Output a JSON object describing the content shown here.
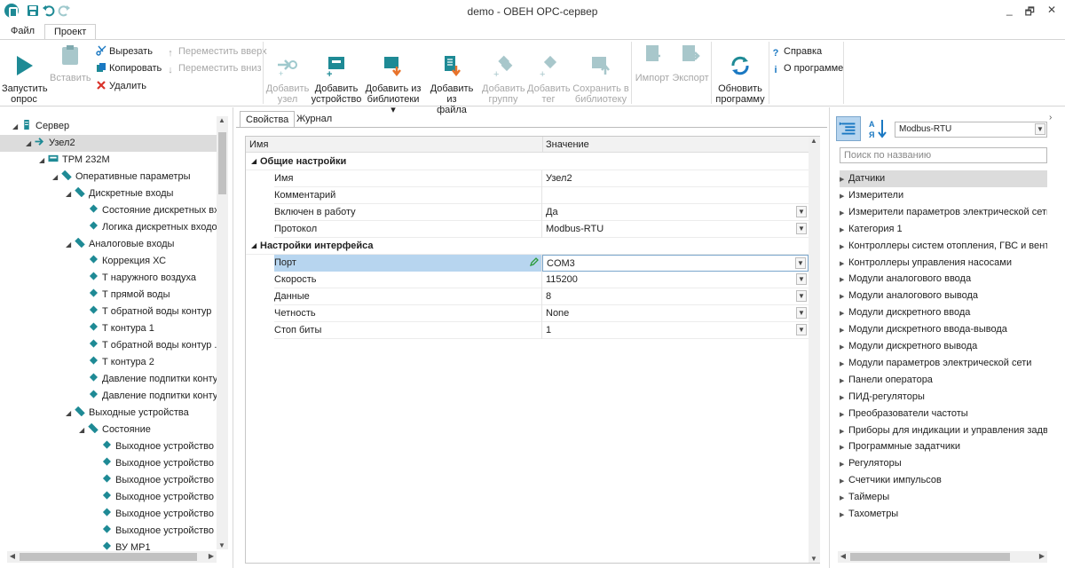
{
  "window": {
    "title": "demo - ОВЕН OPC-сервер",
    "controls": [
      "_",
      "🗗",
      "✕"
    ]
  },
  "menu_tabs": [
    "Файл",
    "Проект"
  ],
  "ribbon": {
    "start_poll": "Запустить\nопрос",
    "paste": "Вставить",
    "cut": "Вырезать",
    "copy": "Копировать",
    "delete": "Удалить",
    "move_up": "Переместить вверх",
    "move_down": "Переместить вниз",
    "add_node": "Добавить\nузел",
    "add_device": "Добавить\nустройство",
    "add_from_library": "Добавить из\nбиблиотеки ▾",
    "add_from_file": "Добавить из\nфайла",
    "add_group": "Добавить\nгруппу",
    "add_tag": "Добавить\nтег",
    "save_to_library": "Сохранить в\nбиблиотеку",
    "import": "Импорт",
    "export": "Экспорт",
    "update_program": "Обновить\nпрограмму",
    "help": "Справка",
    "about": "О программе"
  },
  "tree": [
    {
      "label": "Сервер",
      "level": 0,
      "icon": "server-icon",
      "expanded": true
    },
    {
      "label": "Узел2",
      "level": 1,
      "icon": "node-arrow-icon",
      "expanded": true,
      "selected": true
    },
    {
      "label": "ТРМ 232М",
      "level": 2,
      "icon": "device-icon",
      "expanded": true
    },
    {
      "label": "Оперативные параметры",
      "level": 3,
      "icon": "group-icon",
      "expanded": true
    },
    {
      "label": "Дискретные входы",
      "level": 4,
      "icon": "group-icon",
      "expanded": true
    },
    {
      "label": "Состояние дискретных вх",
      "level": 5,
      "icon": "tag-icon"
    },
    {
      "label": "Логика дискретных входо",
      "level": 5,
      "icon": "tag-icon"
    },
    {
      "label": "Аналоговые входы",
      "level": 4,
      "icon": "group-icon",
      "expanded": true
    },
    {
      "label": "Коррекция ХС",
      "level": 5,
      "icon": "tag-icon"
    },
    {
      "label": "Т наружного воздуха",
      "level": 5,
      "icon": "tag-icon"
    },
    {
      "label": "Т прямой воды",
      "level": 5,
      "icon": "tag-icon"
    },
    {
      "label": "Т обратной воды контур",
      "level": 5,
      "icon": "tag-icon"
    },
    {
      "label": "Т контура 1",
      "level": 5,
      "icon": "tag-icon"
    },
    {
      "label": "Т обратной воды контур .",
      "level": 5,
      "icon": "tag-icon"
    },
    {
      "label": "Т контура 2",
      "level": 5,
      "icon": "tag-icon"
    },
    {
      "label": "Давление подпитки конту",
      "level": 5,
      "icon": "tag-icon"
    },
    {
      "label": "Давление подпитки конту",
      "level": 5,
      "icon": "tag-icon"
    },
    {
      "label": "Выходные устройства",
      "level": 4,
      "icon": "group-icon",
      "expanded": true
    },
    {
      "label": "Состояние",
      "level": 5,
      "icon": "group-icon",
      "expanded": true
    },
    {
      "label": "Выходное устройство",
      "level": 6,
      "icon": "tag-icon"
    },
    {
      "label": "Выходное устройство",
      "level": 6,
      "icon": "tag-icon"
    },
    {
      "label": "Выходное устройство",
      "level": 6,
      "icon": "tag-icon"
    },
    {
      "label": "Выходное устройство",
      "level": 6,
      "icon": "tag-icon"
    },
    {
      "label": "Выходное устройство",
      "level": 6,
      "icon": "tag-icon"
    },
    {
      "label": "Выходное устройство",
      "level": 6,
      "icon": "tag-icon"
    },
    {
      "label": "ВУ МР1",
      "level": 6,
      "icon": "tag-icon"
    }
  ],
  "center_tabs": [
    "Свойства",
    "Журнал"
  ],
  "grid": {
    "col_name": "Имя",
    "col_value": "Значение",
    "rows": [
      {
        "type": "category",
        "name": "Общие настройки"
      },
      {
        "type": "prop",
        "name": "Имя",
        "value": "Узел2"
      },
      {
        "type": "prop",
        "name": "Комментарий",
        "value": ""
      },
      {
        "type": "prop",
        "name": "Включен в работу",
        "value": "Да",
        "dropdown": true
      },
      {
        "type": "prop",
        "name": "Протокол",
        "value": "Modbus-RTU",
        "dropdown": true
      },
      {
        "type": "category",
        "name": "Настройки интерфейса"
      },
      {
        "type": "prop",
        "name": "Порт",
        "value": "COM3",
        "dropdown": true,
        "selected": true
      },
      {
        "type": "prop",
        "name": "Скорость",
        "value": "115200",
        "dropdown": true
      },
      {
        "type": "prop",
        "name": "Данные",
        "value": "8",
        "dropdown": true
      },
      {
        "type": "prop",
        "name": "Четность",
        "value": "None",
        "dropdown": true
      },
      {
        "type": "prop",
        "name": "Стоп биты",
        "value": "1",
        "dropdown": true
      }
    ]
  },
  "library": {
    "protocol_select": "Modbus-RTU",
    "search_placeholder": "Поиск по названию",
    "categories": [
      "Датчики",
      "Измерители",
      "Измерители параметров электрической сети",
      "Категория 1",
      "Контроллеры систем отопления, ГВС и вентиляции",
      "Контроллеры управления насосами",
      "Модули аналогового ввода",
      "Модули аналогового вывода",
      "Модули дискретного ввода",
      "Модули дискретного ввода-вывода",
      "Модули дискретного вывода",
      "Модули параметров электрической сети",
      "Панели оператора",
      "ПИД-регуляторы",
      "Преобразователи частоты",
      "Приборы для индикации и управления задвижками",
      "Программные задатчики",
      "Регуляторы",
      "Счетчики импульсов",
      "Таймеры",
      "Тахометры"
    ]
  },
  "colors": {
    "accent": "#1e8a95",
    "selection": "#b7d5ef",
    "tree_selected": "#dcdcdc",
    "icon_orange": "#e8722a",
    "icon_blue": "#1a78c2"
  }
}
